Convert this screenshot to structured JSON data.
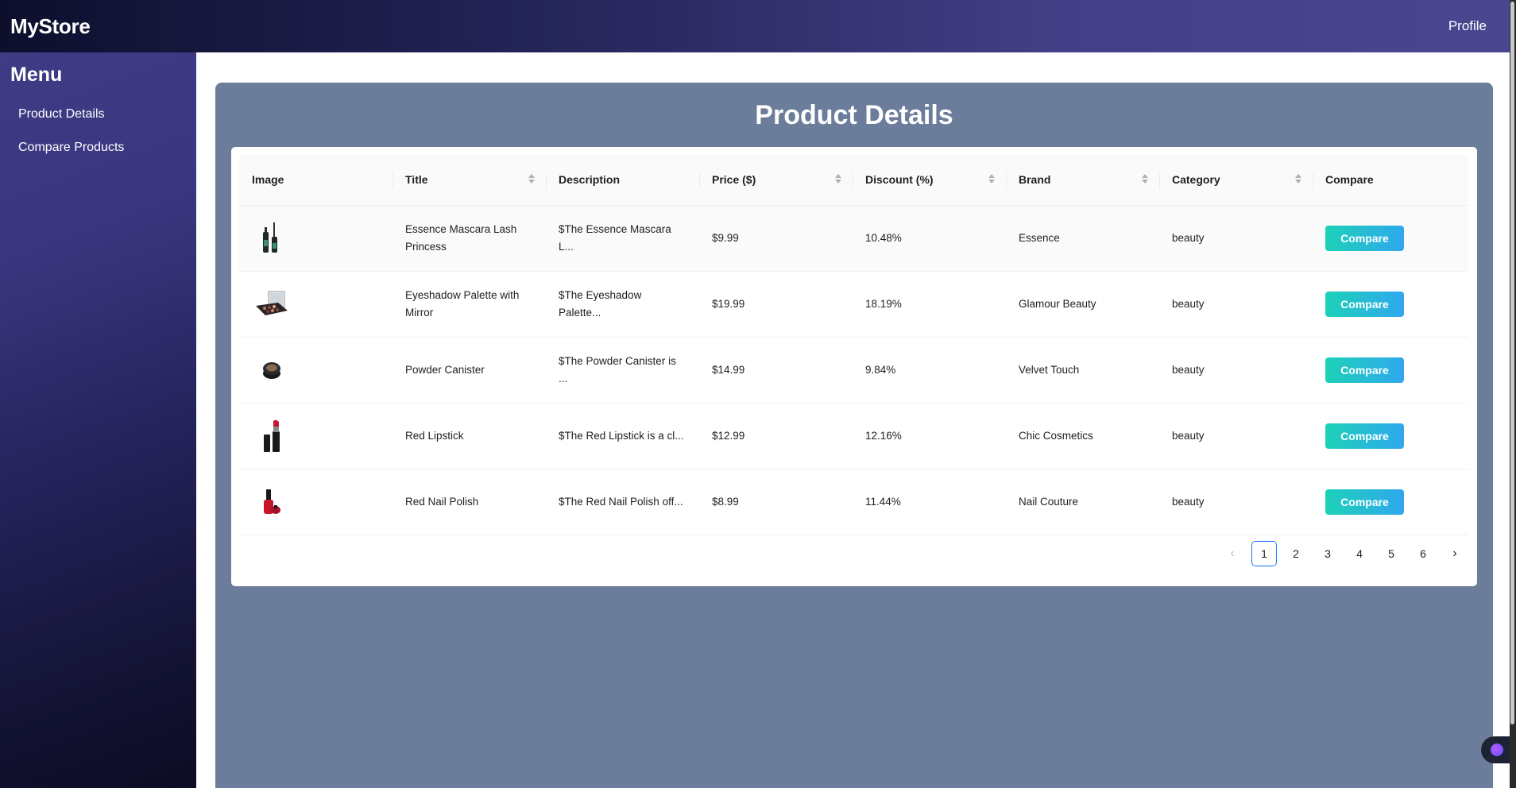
{
  "header": {
    "brand": "MyStore",
    "profile": "Profile"
  },
  "sidebar": {
    "title": "Menu",
    "items": [
      {
        "label": "Product Details"
      },
      {
        "label": "Compare Products"
      }
    ]
  },
  "main": {
    "title": "Product Details"
  },
  "table": {
    "columns": [
      "Image",
      "Title",
      "Description",
      "Price ($)",
      "Discount (%)",
      "Brand",
      "Category",
      "Compare"
    ],
    "rows": [
      {
        "image": "mascara-icon",
        "title": "Essence Mascara Lash Princess",
        "description": "$The Essence Mascara L...",
        "price": "$9.99",
        "discount": "10.48%",
        "brand": "Essence",
        "category": "beauty",
        "action": "Compare"
      },
      {
        "image": "eyeshadow-palette-icon",
        "title": "Eyeshadow Palette with Mirror",
        "description": "$The Eyeshadow Palette...",
        "price": "$19.99",
        "discount": "18.19%",
        "brand": "Glamour Beauty",
        "category": "beauty",
        "action": "Compare"
      },
      {
        "image": "powder-canister-icon",
        "title": "Powder Canister",
        "description": "$The Powder Canister is ...",
        "price": "$14.99",
        "discount": "9.84%",
        "brand": "Velvet Touch",
        "category": "beauty",
        "action": "Compare"
      },
      {
        "image": "lipstick-icon",
        "title": "Red Lipstick",
        "description": "$The Red Lipstick is a cl...",
        "price": "$12.99",
        "discount": "12.16%",
        "brand": "Chic Cosmetics",
        "category": "beauty",
        "action": "Compare"
      },
      {
        "image": "nail-polish-icon",
        "title": "Red Nail Polish",
        "description": "$The Red Nail Polish off...",
        "price": "$8.99",
        "discount": "11.44%",
        "brand": "Nail Couture",
        "category": "beauty",
        "action": "Compare"
      }
    ]
  },
  "pagination": {
    "prev": "‹",
    "pages": [
      "1",
      "2",
      "3",
      "4",
      "5",
      "6"
    ],
    "current": "1",
    "next": "›"
  },
  "colors": {
    "header_start": "#0d0f2d",
    "header_end": "#4a4791",
    "panel": "#6b7d9a",
    "button_start": "#1dd1b8",
    "button_end": "#2fa8ee",
    "active_page_border": "#1677ff"
  }
}
